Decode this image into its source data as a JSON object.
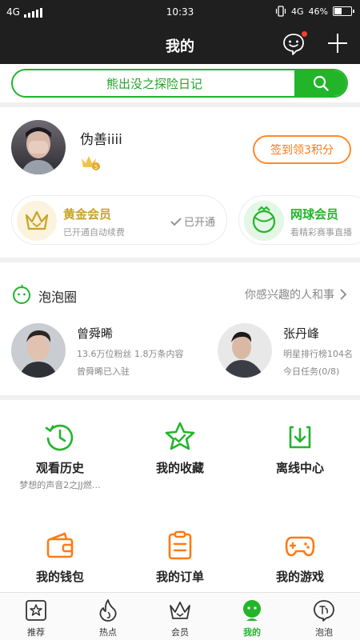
{
  "status_bar": {
    "network": "4G",
    "time": "10:33",
    "network_right": "4G",
    "battery_text": "46%",
    "battery_level": 0.46
  },
  "nav": {
    "title": "我的"
  },
  "search": {
    "value": "熊出没之探险日记"
  },
  "profile": {
    "username": "伪善iiii",
    "vip_level": "5",
    "signin_label": "签到领3积分"
  },
  "memberships": [
    {
      "title": "黄金会员",
      "subtitle": "已开通自动续费",
      "status": "已开通",
      "color": "#c9a227"
    },
    {
      "title": "网球会员",
      "subtitle": "看精彩赛事直播",
      "color": "#22b52a"
    }
  ],
  "bubble": {
    "title": "泡泡圈",
    "more_label": "你感兴趣的人和事",
    "stars": [
      {
        "name": "曾舜晞",
        "line1": "13.6万位粉丝 1.8万条内容",
        "line2": "曾舜晞已入驻"
      },
      {
        "name": "张丹峰",
        "line1": "明星排行榜104名",
        "line2": "今日任务(0/8)"
      }
    ]
  },
  "grid": [
    {
      "label": "观看历史",
      "sub": "梦想的声音2之JJ燃…",
      "icon": "history-icon",
      "color": "#22b52a"
    },
    {
      "label": "我的收藏",
      "sub": "",
      "icon": "star-icon",
      "color": "#22b52a"
    },
    {
      "label": "离线中心",
      "sub": "",
      "icon": "download-icon",
      "color": "#22b52a"
    },
    {
      "label": "我的钱包",
      "sub": "",
      "icon": "wallet-icon",
      "color": "#ff7a14"
    },
    {
      "label": "我的订单",
      "sub": "",
      "icon": "order-icon",
      "color": "#ff7a14"
    },
    {
      "label": "我的游戏",
      "sub": "",
      "icon": "gamepad-icon",
      "color": "#ff7a14"
    }
  ],
  "tabs": [
    {
      "label": "推荐",
      "icon": "recommend-icon"
    },
    {
      "label": "热点",
      "icon": "flame-icon"
    },
    {
      "label": "会员",
      "icon": "crown-icon"
    },
    {
      "label": "我的",
      "icon": "profile-icon",
      "active": true
    },
    {
      "label": "泡泡",
      "icon": "bubble-icon"
    }
  ],
  "colors": {
    "accent": "#22b52a",
    "orange": "#ff7a14",
    "dark_bar": "#1f1f1f"
  }
}
